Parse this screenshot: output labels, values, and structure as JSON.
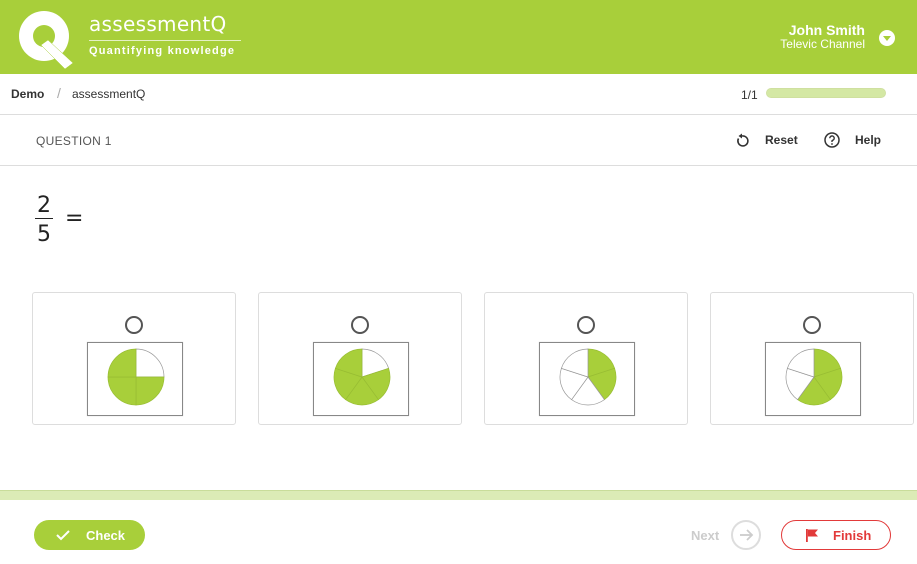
{
  "app": {
    "brand": "assessmentQ",
    "tagline": "Quantifying knowledge",
    "accent_color": "#a8cf3a",
    "danger_color": "#e23a3a"
  },
  "user": {
    "name": "John Smith",
    "channel": "Televic Channel"
  },
  "breadcrumb": {
    "items": [
      "Demo",
      "assessmentQ"
    ],
    "separator": "/"
  },
  "progress": {
    "text": "1/1",
    "fraction": 1
  },
  "question": {
    "label": "QUESTION 1",
    "reset_label": "Reset",
    "help_label": "Help",
    "fraction_numerator": "2",
    "fraction_denominator": "5",
    "equals": "="
  },
  "options": [
    {
      "selected": false,
      "pie_filled": 3,
      "pie_total": 4,
      "filled_first": false
    },
    {
      "selected": false,
      "pie_filled": 4,
      "pie_total": 5,
      "filled_first": false
    },
    {
      "selected": false,
      "pie_filled": 2,
      "pie_total": 5,
      "filled_first": true
    },
    {
      "selected": false,
      "pie_filled": 3,
      "pie_total": 5,
      "filled_first": true
    }
  ],
  "footer": {
    "check_label": "Check",
    "next_label": "Next",
    "finish_label": "Finish"
  },
  "icons": {
    "logo": "q-logo-icon",
    "user_menu": "chevron-down-icon",
    "reset": "reset-icon",
    "help": "help-icon",
    "check": "check-icon",
    "next": "arrow-right-icon",
    "finish": "flag-icon"
  }
}
